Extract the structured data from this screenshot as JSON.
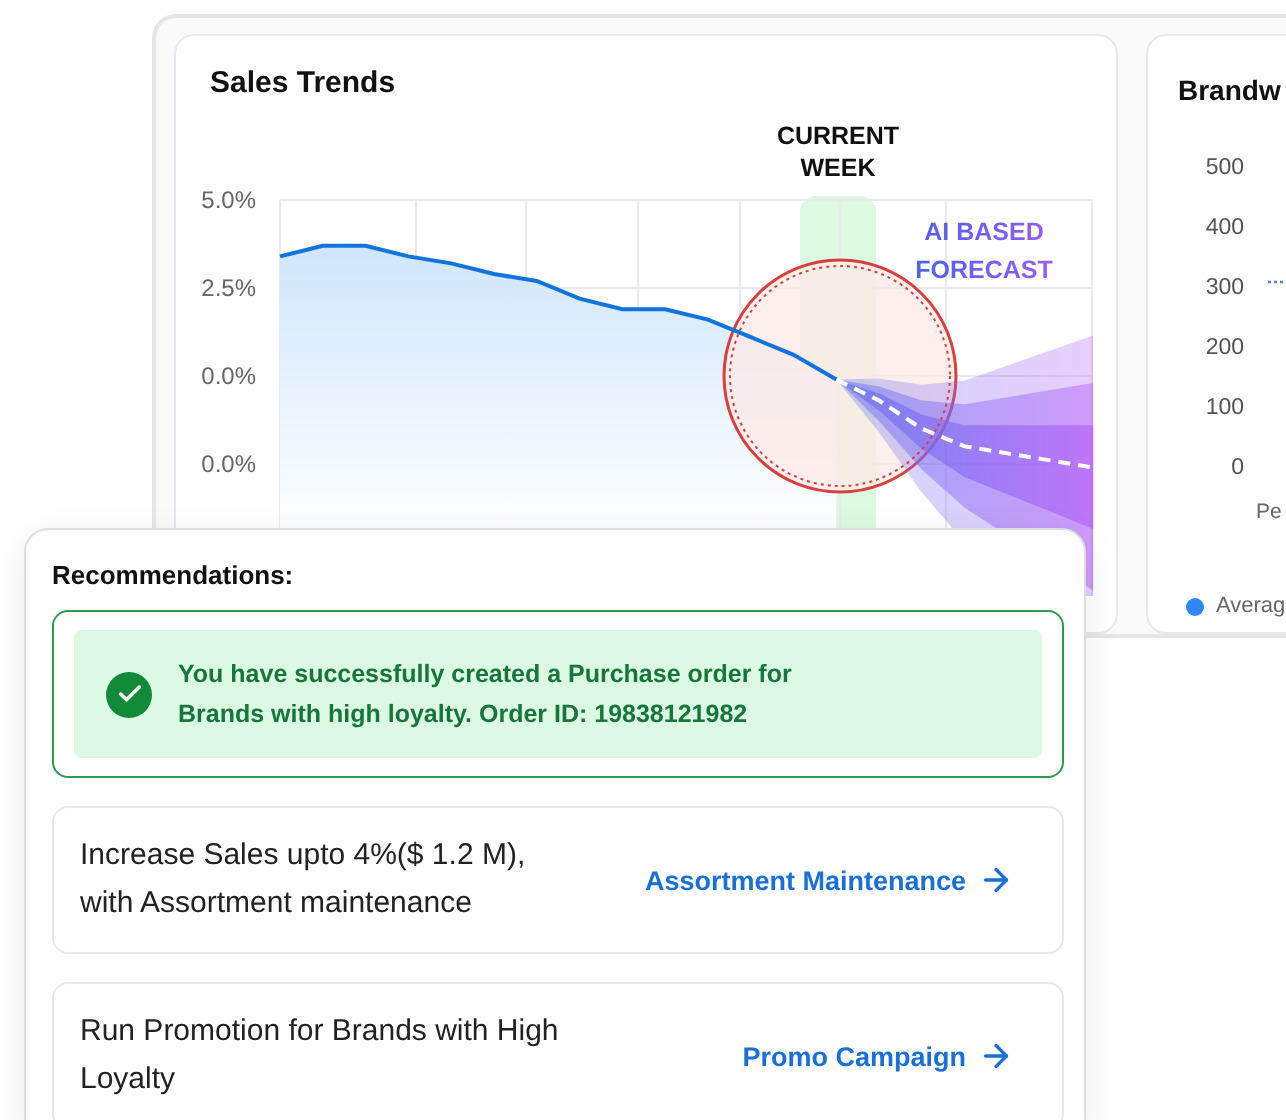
{
  "sales_trends": {
    "title": "Sales Trends",
    "y_axis_labels": [
      "5.0%",
      "2.5%",
      "0.0%",
      "0.0%"
    ],
    "current_week_label": "CURRENT WEEK",
    "forecast_label": "AI BASED FORECAST"
  },
  "brand_card": {
    "title": "Brandw",
    "y_ticks": [
      "500",
      "400",
      "300",
      "200",
      "100",
      "0"
    ],
    "x_label": "Pe",
    "legend": [
      {
        "label": "Averag",
        "color": "#2f86f6"
      }
    ]
  },
  "recommendations": {
    "title": "Recommendations:",
    "success": {
      "message": "You have successfully created a Purchase order for Brands with high loyalty. Order ID: 19838121982"
    },
    "items": [
      {
        "text": "Increase Sales upto 4%($ 1.2 M), with Assortment maintenance",
        "action": "Assortment Maintenance"
      },
      {
        "text": "Run Promotion for Brands with High Loyalty",
        "action": "Promo Campaign"
      }
    ]
  }
}
